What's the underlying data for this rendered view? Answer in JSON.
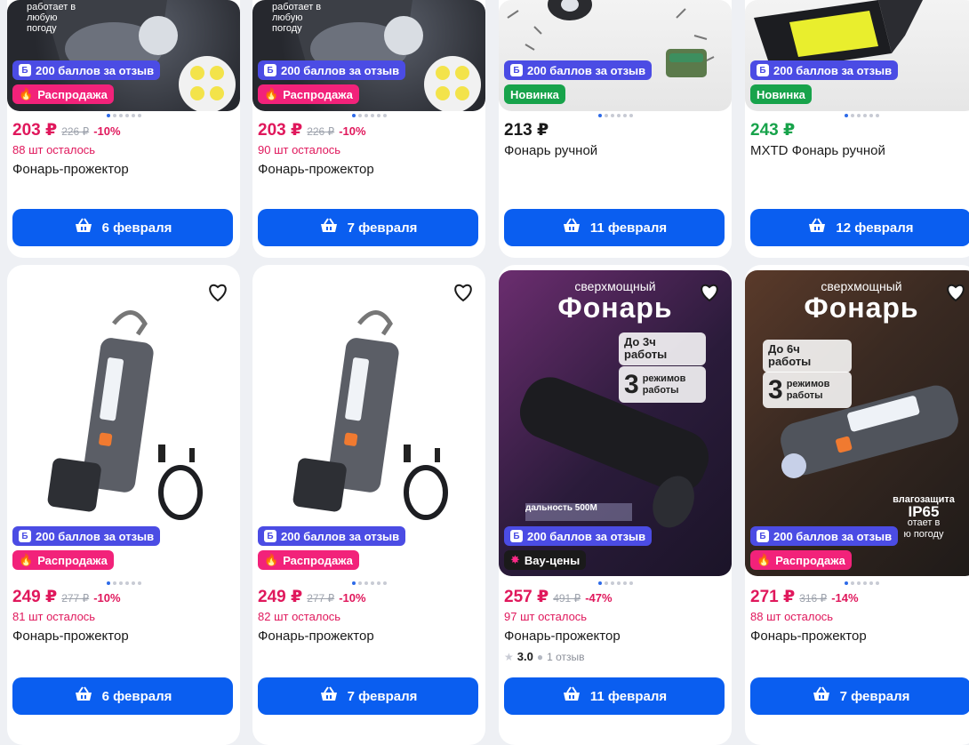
{
  "colors": {
    "price_sale": "#e0185c",
    "button": "#0a5ef0",
    "badge_points": "#4b4ce4",
    "badge_sale": "#f2227a",
    "badge_new": "#18a34b",
    "badge_wow": "#1a1a1a"
  },
  "products": [
    {
      "image_text": "работает в любую погоду",
      "badges": {
        "points": "200 баллов за отзыв",
        "second": "Распродажа"
      },
      "price": "203 ₽",
      "old_price": "226 ₽",
      "discount": "-10%",
      "stock": "88 шт осталось",
      "title": "Фонарь-прожектор",
      "button": "6 февраля"
    },
    {
      "image_text": "работает в любую погоду",
      "badges": {
        "points": "200 баллов за отзыв",
        "second": "Распродажа"
      },
      "price": "203 ₽",
      "old_price": "226 ₽",
      "discount": "-10%",
      "stock": "90 шт осталось",
      "title": "Фонарь-прожектор",
      "button": "7 февраля"
    },
    {
      "badges": {
        "points": "200 баллов за отзыв",
        "second": "Новинка"
      },
      "price": "213 ₽",
      "title": "Фонарь ручной",
      "button": "11 февраля"
    },
    {
      "badges": {
        "points": "200 баллов за отзыв",
        "second": "Новинка"
      },
      "price": "243 ₽",
      "title": "MXTD Фонарь ручной",
      "button": "12 февраля"
    },
    {
      "badges": {
        "points": "200 баллов за отзыв",
        "second": "Распродажа"
      },
      "price": "249 ₽",
      "old_price": "277 ₽",
      "discount": "-10%",
      "stock": "81 шт осталось",
      "title": "Фонарь-прожектор",
      "button": "6 февраля"
    },
    {
      "badges": {
        "points": "200 баллов за отзыв",
        "second": "Распродажа"
      },
      "price": "249 ₽",
      "old_price": "277 ₽",
      "discount": "-10%",
      "stock": "82 шт осталось",
      "title": "Фонарь-прожектор",
      "button": "7 февраля"
    },
    {
      "image": {
        "line1": "сверхмощный",
        "line2": "Фонарь",
        "hours_a": "До 3ч",
        "hours_b": "работы",
        "modes_num": "3",
        "modes_a": "режимов",
        "modes_b": "работы",
        "range": "дальность 500М"
      },
      "badges": {
        "points": "200 баллов за отзыв",
        "second": "Вау-цены"
      },
      "price": "257 ₽",
      "old_price": "491 ₽",
      "discount": "-47%",
      "stock": "97 шт осталось",
      "title": "Фонарь-прожектор",
      "rating": "3.0",
      "reviews": "1 отзыв",
      "button": "11 февраля"
    },
    {
      "image": {
        "line1": "сверхмощный",
        "line2": "Фонарь",
        "hours_a": "До 6ч",
        "hours_b": "работы",
        "modes_num": "3",
        "modes_a": "режимов",
        "modes_b": "работы",
        "protect_a": "влагозащита",
        "protect_b": "IP65",
        "protect_c": "отает в",
        "protect_d": "ю погоду"
      },
      "badges": {
        "points": "200 баллов за отзыв",
        "second": "Распродажа"
      },
      "price": "271 ₽",
      "old_price": "316 ₽",
      "discount": "-14%",
      "stock": "88 шт осталось",
      "title": "Фонарь-прожектор",
      "button": "7 февраля"
    }
  ]
}
